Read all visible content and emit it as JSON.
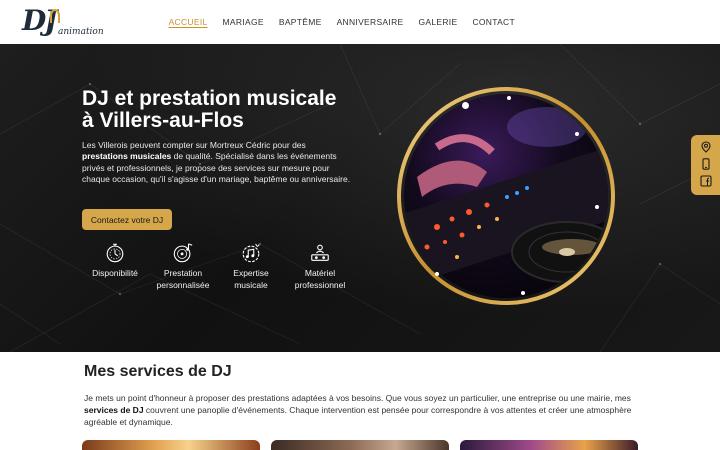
{
  "logo": {
    "text": "DJ",
    "subtext": "animation"
  },
  "nav": {
    "items": [
      "ACCUEIL",
      "MARIAGE",
      "BAPTÊME",
      "ANNIVERSAIRE",
      "GALERIE",
      "CONTACT"
    ],
    "active": "ACCUEIL"
  },
  "hero": {
    "title_line1": "DJ et prestation musicale",
    "title_line2": "à Villers-au-Flos",
    "intro_1": "Les Villerois peuvent compter sur Mortreux Cédric pour des",
    "intro_bold": "prestations musicales",
    "intro_2": " de qualité. Spécialisé dans les événements privés et professionnels, je propose des services sur mesure pour chaque occasion, qu'il s'agisse d'un mariage, baptême ou anniversaire.",
    "cta_label": "Contactez votre DJ",
    "features": [
      {
        "icon": "stopwatch-icon",
        "line1": "Disponibilité",
        "line2": ""
      },
      {
        "icon": "vinyl-note-icon",
        "line1": "Prestation",
        "line2": "personnalisée"
      },
      {
        "icon": "music-notes-icon",
        "line1": "Expertise",
        "line2": "musicale"
      },
      {
        "icon": "dj-turntable-icon",
        "line1": "Matériel",
        "line2": "professionnel"
      }
    ]
  },
  "side_bar": {
    "icons": [
      "map-pin-icon",
      "phone-icon",
      "facebook-icon"
    ]
  },
  "services": {
    "title": "Mes services de DJ",
    "text_1": "Je mets un point d'honneur à proposer des prestations adaptées à vos besoins. Que vous soyez un particulier, une entreprise ou une mairie, mes ",
    "text_bold": "services de DJ",
    "text_2": " couvrent une panoplie d'événements. Chaque intervention est pensée pour correspondre à vos attentes et créer une atmosphère agréable et dynamique."
  },
  "colors": {
    "accent": "#d6a64a",
    "active_nav": "#c9912e",
    "hero_bg": "#151515",
    "logo_blue": "#1d2b3a"
  }
}
